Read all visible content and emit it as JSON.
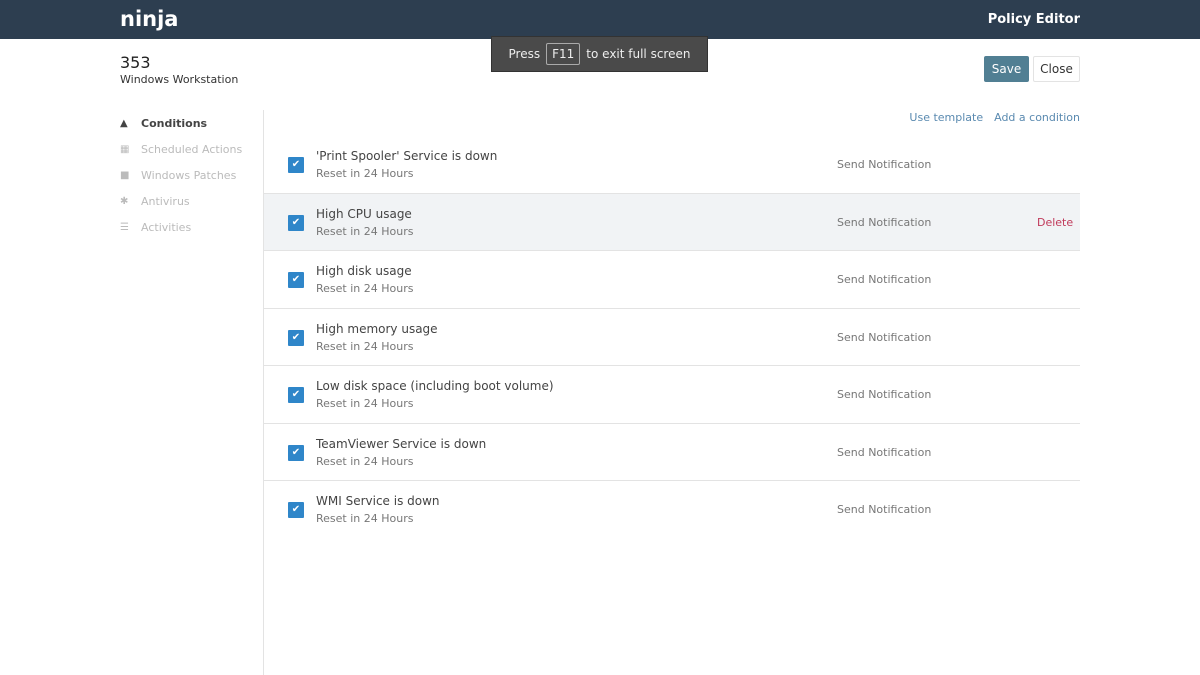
{
  "header": {
    "logo": "ninja",
    "title": "Policy Editor"
  },
  "toast": {
    "prefix": "Press",
    "key": "F11",
    "suffix": "to exit full screen"
  },
  "policy": {
    "number": "353",
    "type": "Windows Workstation"
  },
  "buttons": {
    "save": "Save",
    "close": "Close"
  },
  "sidebar": {
    "items": [
      {
        "label": "Conditions",
        "icon": "warning-icon"
      },
      {
        "label": "Scheduled Actions",
        "icon": "calendar-icon"
      },
      {
        "label": "Windows Patches",
        "icon": "windows-icon"
      },
      {
        "label": "Antivirus",
        "icon": "bug-icon"
      },
      {
        "label": "Activities",
        "icon": "list-icon"
      }
    ]
  },
  "links": {
    "use_template": "Use template",
    "add_condition": "Add a condition"
  },
  "conditions": [
    {
      "title": "'Print Spooler' Service is down",
      "reset": "Reset in 24 Hours",
      "action": "Send Notification"
    },
    {
      "title": "High CPU usage",
      "reset": "Reset in 24 Hours",
      "action": "Send Notification",
      "delete": "Delete"
    },
    {
      "title": "High disk usage",
      "reset": "Reset in 24 Hours",
      "action": "Send Notification"
    },
    {
      "title": "High memory usage",
      "reset": "Reset in 24 Hours",
      "action": "Send Notification"
    },
    {
      "title": "Low disk space (including boot volume)",
      "reset": "Reset in 24 Hours",
      "action": "Send Notification"
    },
    {
      "title": "TeamViewer Service is down",
      "reset": "Reset in 24 Hours",
      "action": "Send Notification"
    },
    {
      "title": "WMI Service is down",
      "reset": "Reset in 24 Hours",
      "action": "Send Notification"
    }
  ]
}
